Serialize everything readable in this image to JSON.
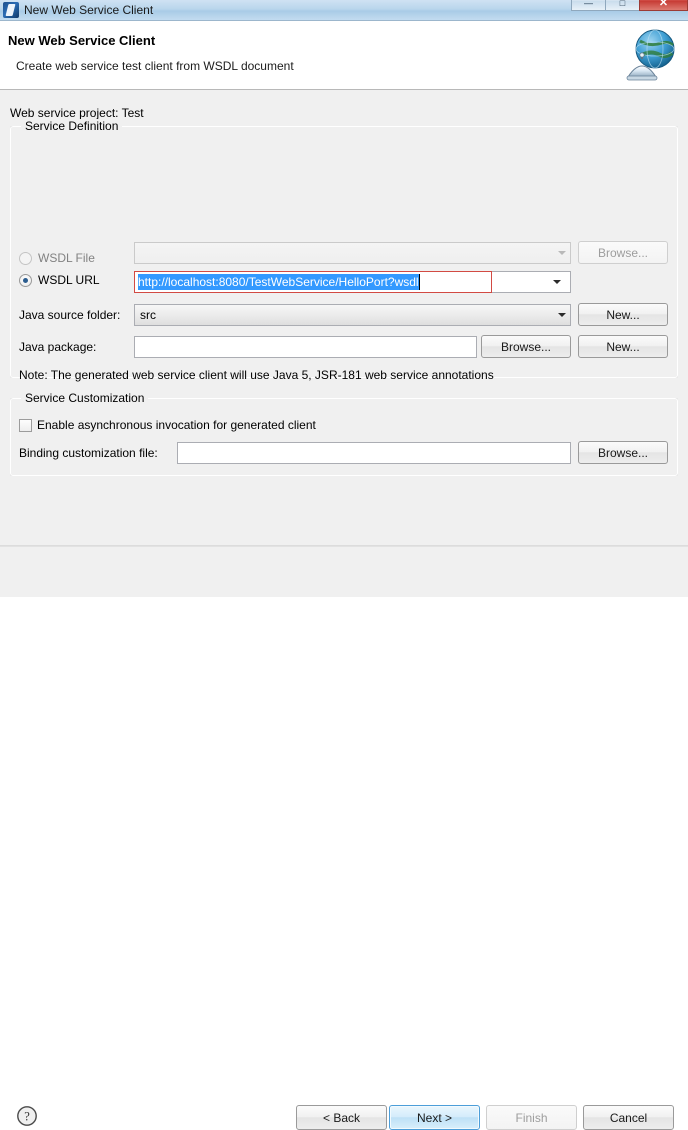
{
  "window": {
    "title": "New Web Service Client",
    "app_icon": "eclipse-icon",
    "controls": {
      "minimize": "—",
      "maximize": "□",
      "close": "✕"
    }
  },
  "header": {
    "title": "New Web Service Client",
    "description": "Create web service test client from WSDL document",
    "banner_icon": "globe-server-icon"
  },
  "main": {
    "project_label": "Web service project: Test",
    "service_definition": {
      "group_title": "Service Definition",
      "wsdl_file": {
        "radio_label": "WSDL File",
        "selected": false,
        "enabled": false,
        "combo_value": "",
        "browse_label": "Browse...",
        "browse_enabled": false
      },
      "wsdl_url": {
        "radio_label": "WSDL URL",
        "selected": true,
        "enabled": true,
        "combo_value": "http://localhost:8080/TestWebService/HelloPort?wsdl",
        "text_selected": true,
        "error": true
      },
      "java_source_folder": {
        "label": "Java source folder:",
        "value": "src",
        "new_label": "New..."
      },
      "java_package": {
        "label": "Java package:",
        "value": "",
        "browse_label": "Browse...",
        "new_label": "New..."
      },
      "note": "Note: The generated web service client will use Java 5, JSR-181 web service annotations"
    },
    "service_customization": {
      "group_title": "Service Customization",
      "async_checkbox": {
        "label": "Enable asynchronous invocation for generated client",
        "checked": false
      },
      "binding_file": {
        "label": "Binding customization file:",
        "value": "",
        "browse_label": "Browse..."
      }
    }
  },
  "footer": {
    "help_icon": "help-question-icon",
    "buttons": {
      "back": {
        "label": "< Back",
        "enabled": true,
        "default": false
      },
      "next": {
        "label": "Next >",
        "enabled": true,
        "default": true
      },
      "finish": {
        "label": "Finish",
        "enabled": false,
        "default": false
      },
      "cancel": {
        "label": "Cancel",
        "enabled": true,
        "default": false
      }
    }
  },
  "colors": {
    "accent": "#3399ff",
    "error_border": "#d24a43",
    "default_button_border": "#4c9ed9",
    "titlebar": "#b9d6ec"
  }
}
